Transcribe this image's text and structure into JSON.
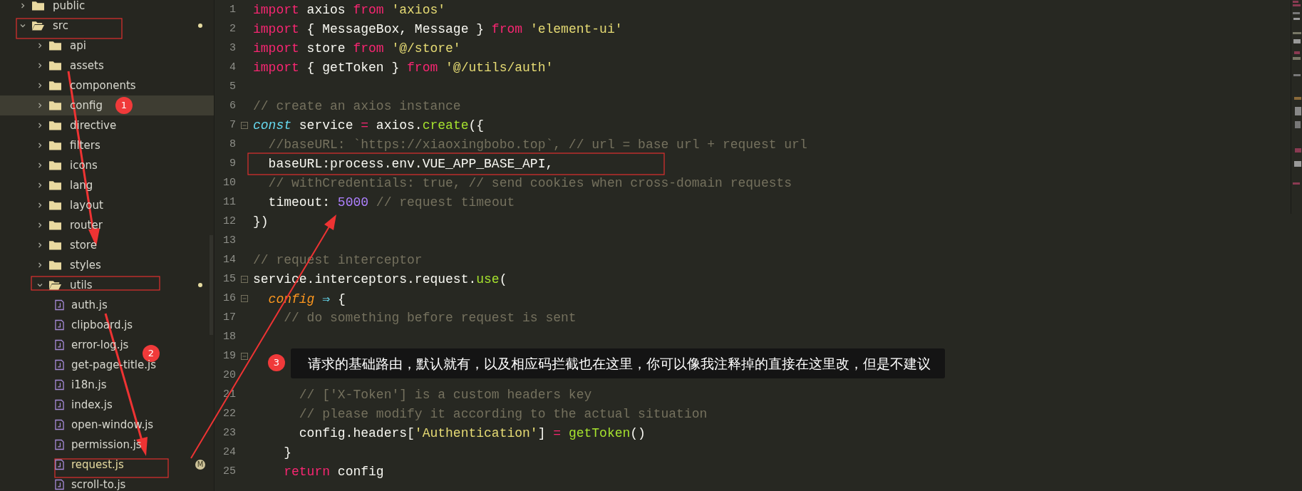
{
  "sidebar": {
    "items": [
      {
        "name": "public",
        "kind": "folder",
        "expanded": false,
        "selected": false,
        "modified": false
      },
      {
        "name": "src",
        "kind": "folder",
        "expanded": true,
        "selected": false,
        "modified": true,
        "children": [
          {
            "name": "api",
            "kind": "folder",
            "expanded": false,
            "selected": false,
            "modified": false
          },
          {
            "name": "assets",
            "kind": "folder",
            "expanded": false,
            "selected": false,
            "modified": false
          },
          {
            "name": "components",
            "kind": "folder",
            "expanded": false,
            "selected": false,
            "modified": false
          },
          {
            "name": "config",
            "kind": "folder",
            "expanded": false,
            "selected": true,
            "modified": false
          },
          {
            "name": "directive",
            "kind": "folder",
            "expanded": false,
            "selected": false,
            "modified": false
          },
          {
            "name": "filters",
            "kind": "folder",
            "expanded": false,
            "selected": false,
            "modified": false
          },
          {
            "name": "icons",
            "kind": "folder",
            "expanded": false,
            "selected": false,
            "modified": false
          },
          {
            "name": "lang",
            "kind": "folder",
            "expanded": false,
            "selected": false,
            "modified": false
          },
          {
            "name": "layout",
            "kind": "folder",
            "expanded": false,
            "selected": false,
            "modified": false
          },
          {
            "name": "router",
            "kind": "folder",
            "expanded": false,
            "selected": false,
            "modified": false
          },
          {
            "name": "store",
            "kind": "folder",
            "expanded": false,
            "selected": false,
            "modified": false
          },
          {
            "name": "styles",
            "kind": "folder",
            "expanded": false,
            "selected": false,
            "modified": false
          },
          {
            "name": "utils",
            "kind": "folder",
            "expanded": true,
            "selected": false,
            "modified": true,
            "children": [
              {
                "name": "auth.js",
                "kind": "file",
                "selected": false,
                "modified": false
              },
              {
                "name": "clipboard.js",
                "kind": "file",
                "selected": false,
                "modified": false
              },
              {
                "name": "error-log.js",
                "kind": "file",
                "selected": false,
                "modified": false
              },
              {
                "name": "get-page-title.js",
                "kind": "file",
                "selected": false,
                "modified": false
              },
              {
                "name": "i18n.js",
                "kind": "file",
                "selected": false,
                "modified": false
              },
              {
                "name": "index.js",
                "kind": "file",
                "selected": false,
                "modified": false
              },
              {
                "name": "open-window.js",
                "kind": "file",
                "selected": false,
                "modified": false
              },
              {
                "name": "permission.js",
                "kind": "file",
                "selected": false,
                "modified": false
              },
              {
                "name": "request.js",
                "kind": "file",
                "selected": false,
                "modified": true,
                "badge": "M"
              },
              {
                "name": "scroll-to.js",
                "kind": "file",
                "selected": false,
                "modified": false
              }
            ]
          }
        ]
      }
    ]
  },
  "editor": {
    "lines": [
      {
        "number": "1",
        "fold": false,
        "tokens": [
          {
            "text": "import",
            "kind": "keyword"
          },
          {
            "text": " axios ",
            "kind": "plain"
          },
          {
            "text": "from ",
            "kind": "keyword"
          },
          {
            "text": "'axios'",
            "kind": "string"
          }
        ]
      },
      {
        "number": "2",
        "fold": false,
        "tokens": [
          {
            "text": "import",
            "kind": "keyword"
          },
          {
            "text": " { MessageBox, Message } ",
            "kind": "plain"
          },
          {
            "text": "from ",
            "kind": "keyword"
          },
          {
            "text": "'element-ui'",
            "kind": "string"
          }
        ]
      },
      {
        "number": "3",
        "fold": false,
        "tokens": [
          {
            "text": "import",
            "kind": "keyword"
          },
          {
            "text": " store ",
            "kind": "plain"
          },
          {
            "text": "from ",
            "kind": "keyword"
          },
          {
            "text": "'@/store'",
            "kind": "string"
          }
        ]
      },
      {
        "number": "4",
        "fold": false,
        "tokens": [
          {
            "text": "import",
            "kind": "keyword"
          },
          {
            "text": " { getToken } ",
            "kind": "plain"
          },
          {
            "text": "from ",
            "kind": "keyword"
          },
          {
            "text": "'@/utils/auth'",
            "kind": "string"
          }
        ]
      },
      {
        "number": "5",
        "fold": false
      },
      {
        "number": "6",
        "fold": false,
        "tokens": [
          {
            "text": "// create an axios instance",
            "kind": "comment"
          }
        ]
      },
      {
        "number": "7",
        "fold": true,
        "tokens": [
          {
            "text": "const",
            "kind": "storage"
          },
          {
            "text": " service ",
            "kind": "plain"
          },
          {
            "text": "=",
            "kind": "operator"
          },
          {
            "text": " axios.",
            "kind": "plain"
          },
          {
            "text": "create",
            "kind": "function"
          },
          {
            "text": "({",
            "kind": "plain"
          }
        ]
      },
      {
        "number": "8",
        "fold": false,
        "tokens": [
          {
            "text": "  //baseURL: `https://xiaoxingbobo.top`, // url = base url + request url",
            "kind": "comment"
          }
        ]
      },
      {
        "number": "9",
        "fold": false,
        "tokens": [
          {
            "text": "  baseURL:process.env.VUE_APP_BASE_API,",
            "kind": "plain"
          }
        ]
      },
      {
        "number": "10",
        "fold": false,
        "tokens": [
          {
            "text": "  // withCredentials: true, // send cookies when cross-domain requests",
            "kind": "comment"
          }
        ]
      },
      {
        "number": "11",
        "fold": false,
        "tokens": [
          {
            "text": "  timeout: ",
            "kind": "plain"
          },
          {
            "text": "5000",
            "kind": "number"
          },
          {
            "text": " // request timeout",
            "kind": "comment"
          }
        ]
      },
      {
        "number": "12",
        "fold": false,
        "tokens": [
          {
            "text": "})",
            "kind": "plain"
          }
        ]
      },
      {
        "number": "13",
        "fold": false
      },
      {
        "number": "14",
        "fold": false,
        "tokens": [
          {
            "text": "// request interceptor",
            "kind": "comment"
          }
        ]
      },
      {
        "number": "15",
        "fold": true,
        "tokens": [
          {
            "text": "service.interceptors.request.",
            "kind": "plain"
          },
          {
            "text": "use",
            "kind": "function"
          },
          {
            "text": "(",
            "kind": "plain"
          }
        ]
      },
      {
        "number": "16",
        "fold": true,
        "tokens": [
          {
            "text": "  config",
            "kind": "parameter"
          },
          {
            "text": " ⇒ ",
            "kind": "arrow"
          },
          {
            "text": "{",
            "kind": "plain"
          }
        ]
      },
      {
        "number": "17",
        "fold": false,
        "tokens": [
          {
            "text": "    // do something before request is sent",
            "kind": "comment"
          }
        ]
      },
      {
        "number": "18",
        "fold": false
      },
      {
        "number": "19",
        "fold": true
      },
      {
        "number": "20",
        "fold": false
      },
      {
        "number": "21",
        "fold": false,
        "tokens": [
          {
            "text": "      // ['X-Token'] is a custom headers key",
            "kind": "comment"
          }
        ]
      },
      {
        "number": "22",
        "fold": false,
        "tokens": [
          {
            "text": "      // please modify it according to the actual situation",
            "kind": "comment"
          }
        ]
      },
      {
        "number": "23",
        "fold": false,
        "tokens": [
          {
            "text": "      config.headers[",
            "kind": "plain"
          },
          {
            "text": "'Authentication'",
            "kind": "string"
          },
          {
            "text": "] ",
            "kind": "plain"
          },
          {
            "text": "=",
            "kind": "operator"
          },
          {
            "text": " getToken",
            "kind": "function"
          },
          {
            "text": "()",
            "kind": "plain"
          }
        ]
      },
      {
        "number": "24",
        "fold": false,
        "tokens": [
          {
            "text": "    }",
            "kind": "plain"
          }
        ]
      },
      {
        "number": "25",
        "fold": false,
        "tokens": [
          {
            "text": "    return",
            "kind": "keyword"
          },
          {
            "text": " config",
            "kind": "plain"
          }
        ]
      }
    ]
  },
  "annotations": {
    "badges": [
      {
        "label": "1"
      },
      {
        "label": "2"
      },
      {
        "label": "3"
      }
    ],
    "note": "请求的基础路由，默认就有，以及相应码拦截也在这里，你可以像我注释掉的直接在这里改，但是不建议"
  }
}
